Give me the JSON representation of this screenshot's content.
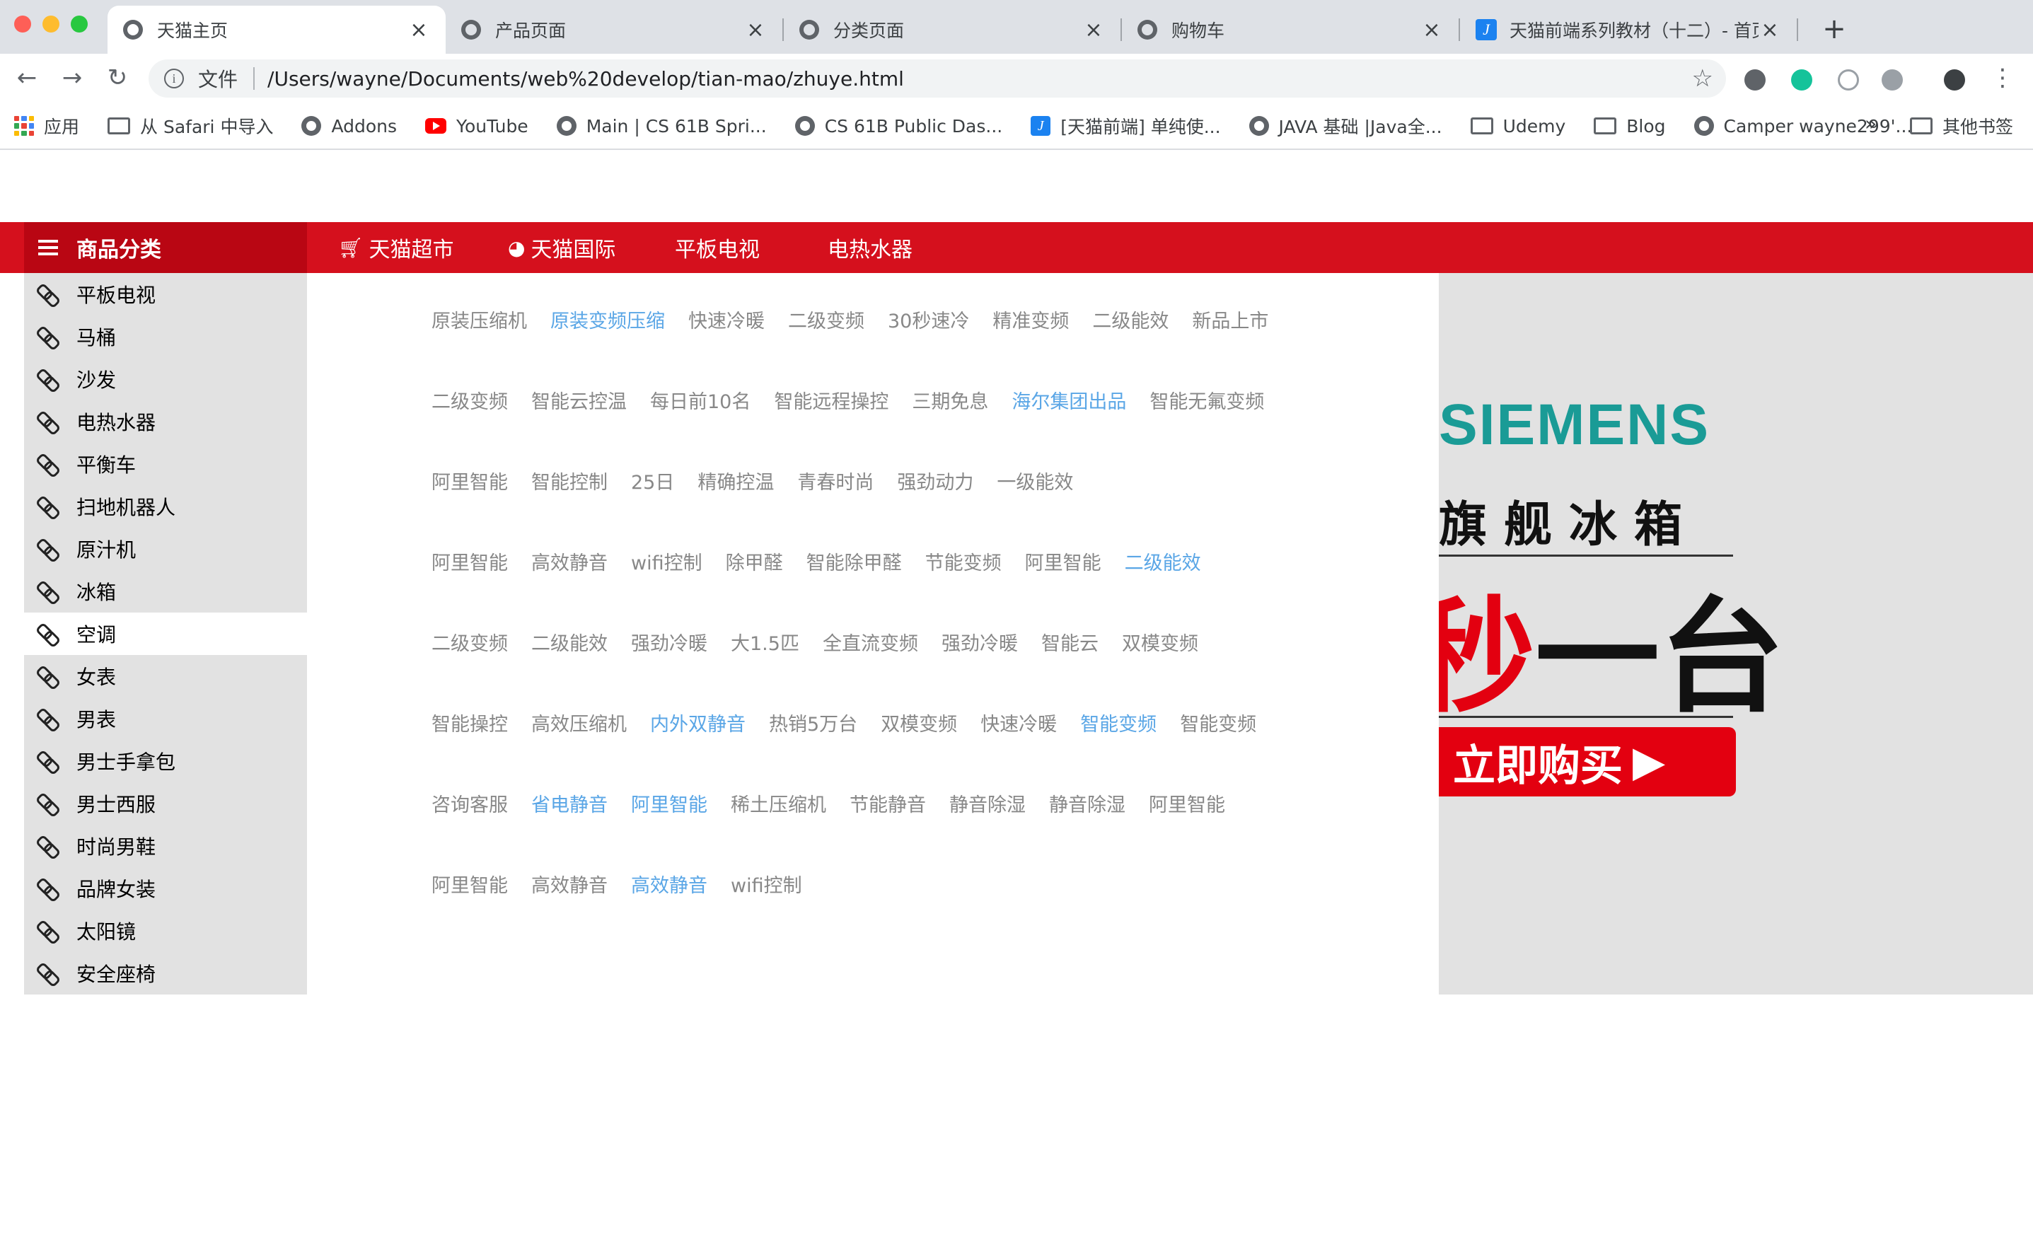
{
  "tabs": [
    {
      "title": "天猫主页",
      "active": true,
      "icon": "globe-icon"
    },
    {
      "title": "产品页面",
      "active": false,
      "icon": "globe-icon"
    },
    {
      "title": "分类页面",
      "active": false,
      "icon": "globe-icon"
    },
    {
      "title": "购物车",
      "active": false,
      "icon": "globe-icon"
    },
    {
      "title": "天猫前端系列教材（十二）- 首页",
      "active": false,
      "icon": "j-icon"
    }
  ],
  "toolbar": {
    "scheme_label": "文件",
    "url": "/Users/wayne/Documents/web%20develop/tian-mao/zhuye.html"
  },
  "bookmarks": [
    {
      "label": "应用",
      "icon": "apps-icon"
    },
    {
      "label": "从 Safari 中导入",
      "icon": "folder-icon"
    },
    {
      "label": "Addons",
      "icon": "globe-icon"
    },
    {
      "label": "YouTube",
      "icon": "youtube-icon"
    },
    {
      "label": "Main | CS 61B Spri...",
      "icon": "globe-icon"
    },
    {
      "label": "CS 61B Public Das...",
      "icon": "globe-icon"
    },
    {
      "label": "[天猫前端] 单纯使...",
      "icon": "j-icon"
    },
    {
      "label": "JAVA 基础 |Java全...",
      "icon": "globe-icon"
    },
    {
      "label": "Udemy",
      "icon": "folder-icon"
    },
    {
      "label": "Blog",
      "icon": "folder-icon"
    },
    {
      "label": "Camper wayne299'...",
      "icon": "globe-icon"
    }
  ],
  "bookmarks_more": "»",
  "bookmarks_other": "其他书签",
  "nav": {
    "category_header": "商品分类",
    "links": [
      {
        "label": "天猫超市",
        "icon": "cart-icon"
      },
      {
        "label": "天猫国际",
        "icon": "globe-icon"
      },
      {
        "label": "平板电视",
        "icon": ""
      },
      {
        "label": "电热水器",
        "icon": ""
      }
    ]
  },
  "categories": [
    "平板电视",
    "马桶",
    "沙发",
    "电热水器",
    "平衡车",
    "扫地机器人",
    "原汁机",
    "冰箱",
    "空调",
    "女表",
    "男表",
    "男士手拿包",
    "男士西服",
    "时尚男鞋",
    "品牌女装",
    "太阳镜",
    "安全座椅"
  ],
  "selected_category": "空调",
  "keyword_rows": [
    [
      {
        "t": "原装压缩机",
        "h": false
      },
      {
        "t": "原装变频压缩",
        "h": true
      },
      {
        "t": "快速冷暖",
        "h": false
      },
      {
        "t": "二级变频",
        "h": false
      },
      {
        "t": "30秒速冷",
        "h": false
      },
      {
        "t": "精准变频",
        "h": false
      },
      {
        "t": "二级能效",
        "h": false
      },
      {
        "t": "新品上市",
        "h": false
      }
    ],
    [
      {
        "t": "二级变频",
        "h": false
      },
      {
        "t": "智能云控温",
        "h": false
      },
      {
        "t": "每日前10名",
        "h": false
      },
      {
        "t": "智能远程操控",
        "h": false
      },
      {
        "t": "三期免息",
        "h": false
      },
      {
        "t": "海尔集团出品",
        "h": true
      },
      {
        "t": "智能无氟变频",
        "h": false
      }
    ],
    [
      {
        "t": "阿里智能",
        "h": false
      },
      {
        "t": "智能控制",
        "h": false
      },
      {
        "t": "25日",
        "h": false
      },
      {
        "t": "精确控温",
        "h": false
      },
      {
        "t": "青春时尚",
        "h": false
      },
      {
        "t": "强劲动力",
        "h": false
      },
      {
        "t": "一级能效",
        "h": false
      }
    ],
    [
      {
        "t": "阿里智能",
        "h": false
      },
      {
        "t": "高效静音",
        "h": false
      },
      {
        "t": "wifi控制",
        "h": false
      },
      {
        "t": "除甲醛",
        "h": false
      },
      {
        "t": "智能除甲醛",
        "h": false
      },
      {
        "t": "节能变频",
        "h": false
      },
      {
        "t": "阿里智能",
        "h": false
      },
      {
        "t": "二级能效",
        "h": true
      }
    ],
    [
      {
        "t": "二级变频",
        "h": false
      },
      {
        "t": "二级能效",
        "h": false
      },
      {
        "t": "强劲冷暖",
        "h": false
      },
      {
        "t": "大1.5匹",
        "h": false
      },
      {
        "t": "全直流变频",
        "h": false
      },
      {
        "t": "强劲冷暖",
        "h": false
      },
      {
        "t": "智能云",
        "h": false
      },
      {
        "t": "双模变频",
        "h": false
      }
    ],
    [
      {
        "t": "智能操控",
        "h": false
      },
      {
        "t": "高效压缩机",
        "h": false
      },
      {
        "t": "内外双静音",
        "h": true
      },
      {
        "t": "热销5万台",
        "h": false
      },
      {
        "t": "双模变频",
        "h": false
      },
      {
        "t": "快速冷暖",
        "h": false
      },
      {
        "t": "智能变频",
        "h": true
      },
      {
        "t": "智能变频",
        "h": false
      }
    ],
    [
      {
        "t": "咨询客服",
        "h": false
      },
      {
        "t": "省电静音",
        "h": true
      },
      {
        "t": "阿里智能",
        "h": true
      },
      {
        "t": "稀土压缩机",
        "h": false
      },
      {
        "t": "节能静音",
        "h": false
      },
      {
        "t": "静音除湿",
        "h": false
      },
      {
        "t": "静音除湿",
        "h": false
      },
      {
        "t": "阿里智能",
        "h": false
      }
    ],
    [
      {
        "t": "阿里智能",
        "h": false
      },
      {
        "t": "高效静音",
        "h": false
      },
      {
        "t": "高效静音",
        "h": true
      },
      {
        "t": "wifi控制",
        "h": false
      }
    ]
  ],
  "banner": {
    "brand": "SIEMENS",
    "subtitle": "旗舰冰箱",
    "headline_red": "秒",
    "headline": "一台",
    "buy_label": "立即购买",
    "brand_color": "#1a9b96",
    "accent_color": "#e30010"
  },
  "colors": {
    "nav_red": "#d5101d",
    "category_header": "#b90613",
    "keyword_highlight": "#5aa6e6",
    "keyword_default": "#888888"
  }
}
